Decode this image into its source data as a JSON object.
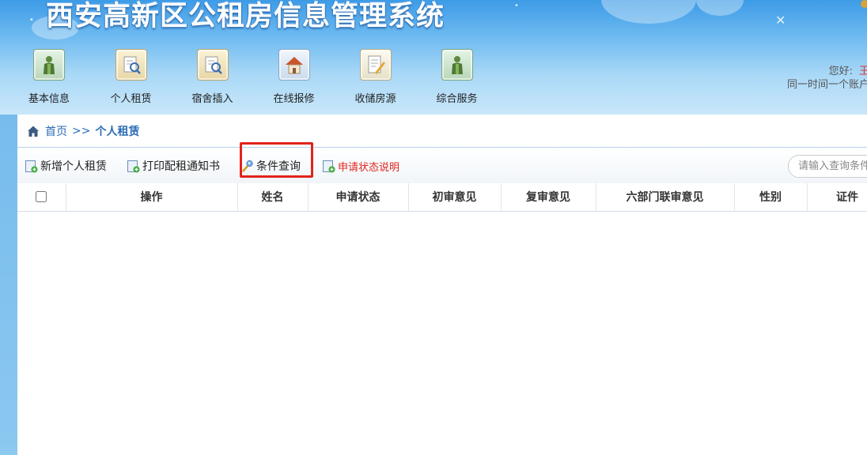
{
  "app": {
    "title": "西安高新区公租房信息管理系统"
  },
  "nav": [
    {
      "label": "基本信息",
      "icon": "person-icon"
    },
    {
      "label": "个人租赁",
      "icon": "document-search-icon"
    },
    {
      "label": "宿舍插入",
      "icon": "document-search-icon"
    },
    {
      "label": "在线报修",
      "icon": "house-icon"
    },
    {
      "label": "收储房源",
      "icon": "edit-document-icon"
    },
    {
      "label": "综合服务",
      "icon": "person-icon"
    }
  ],
  "user": {
    "greeting": "您好:",
    "name": "王仕",
    "notice": "同一时间一个账户只"
  },
  "breadcrumb": {
    "home": "首页",
    "separator": ">>",
    "current": "个人租赁"
  },
  "toolbar": {
    "buttons": [
      {
        "label": "新增个人租赁",
        "icon": "add-document-icon"
      },
      {
        "label": "打印配租通知书",
        "icon": "add-document-icon"
      },
      {
        "label": "条件查询",
        "icon": "magic-wand-icon"
      },
      {
        "label": "申请状态说明",
        "icon": "add-document-icon"
      }
    ],
    "search_placeholder": "请输入查询条件"
  },
  "table": {
    "columns": [
      "操作",
      "姓名",
      "申请状态",
      "初审意见",
      "复审意见",
      "六部门联审意见",
      "性别",
      "证件"
    ]
  },
  "colors": {
    "header_blue": "#3d9be6",
    "link_blue": "#2a6bb5",
    "alert_red": "#e0261f",
    "highlight_red": "#e2231a"
  }
}
